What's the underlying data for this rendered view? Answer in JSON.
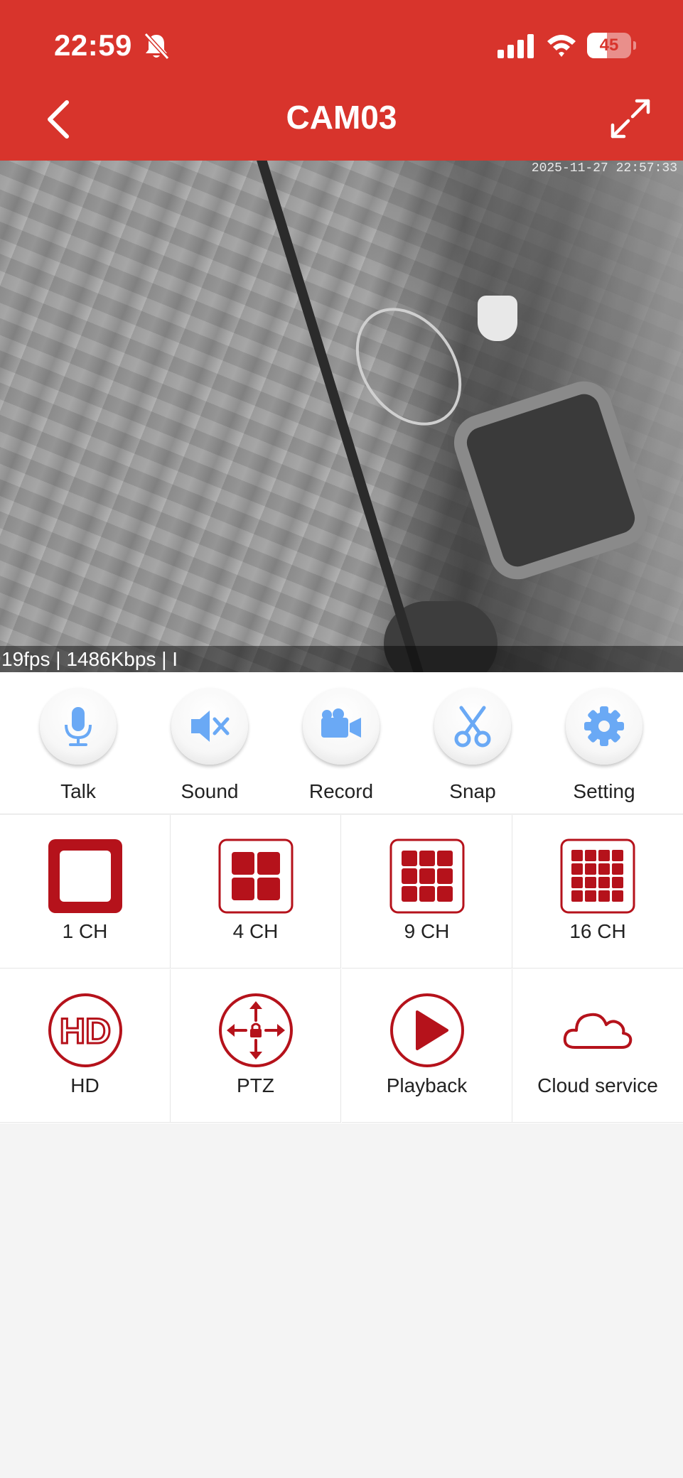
{
  "status_bar": {
    "time": "22:59",
    "battery": "45",
    "battery_level": 0.45
  },
  "header": {
    "title": "CAM03",
    "background_color": "#d8342c"
  },
  "video": {
    "timestamp": "2025-11-27 22:57:33",
    "stream_info": "19fps | 1486Kbps | I"
  },
  "toolbar": {
    "items": [
      {
        "label": "Talk",
        "icon": "microphone-icon"
      },
      {
        "label": "Sound",
        "icon": "speaker-muted-icon"
      },
      {
        "label": "Record",
        "icon": "video-camera-icon"
      },
      {
        "label": "Snap",
        "icon": "scissors-icon"
      },
      {
        "label": "Setting",
        "icon": "gear-icon"
      }
    ],
    "icon_color": "#6aa9f5"
  },
  "grid": {
    "layouts": [
      {
        "label": "1 CH",
        "icon": "single-channel-icon",
        "selected": true
      },
      {
        "label": "4 CH",
        "icon": "four-channel-icon",
        "selected": false
      },
      {
        "label": "9 CH",
        "icon": "nine-channel-icon",
        "selected": false
      },
      {
        "label": "16 CH",
        "icon": "sixteen-channel-icon",
        "selected": false
      }
    ],
    "functions": [
      {
        "label": "HD",
        "icon": "hd-icon"
      },
      {
        "label": "PTZ",
        "icon": "ptz-icon"
      },
      {
        "label": "Playback",
        "icon": "playback-icon"
      },
      {
        "label": "Cloud service",
        "icon": "cloud-icon"
      }
    ],
    "accent_color": "#b5121b"
  }
}
